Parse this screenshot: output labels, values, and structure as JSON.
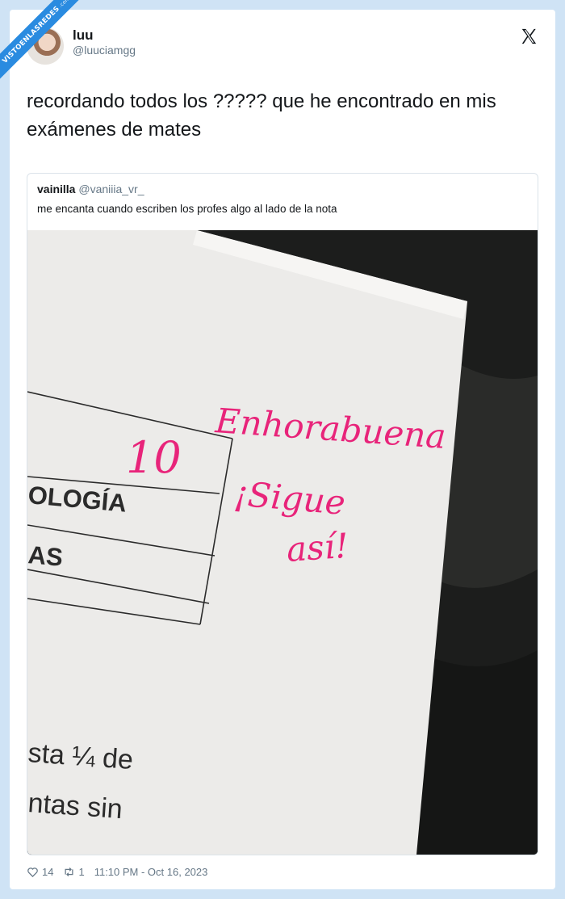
{
  "watermark": {
    "text": "VISTOENLASREDES",
    "suffix": ".com"
  },
  "tweet": {
    "author_name": "luu",
    "author_handle": "@luuciamgg",
    "text": "recordando todos los ????? que he encontrado en mis exámenes de mates",
    "likes": "14",
    "retweets": "1",
    "timestamp": "11:10 PM - Oct 16, 2023"
  },
  "quoted_tweet": {
    "author_name": "vainilla",
    "author_handle": "@vaniiia_vr_",
    "text": "me encanta cuando escriben los profes algo al lado de la nota"
  },
  "photo": {
    "grade": "10",
    "handwriting": [
      "Enhorabuena",
      "¡Sigue",
      "así!"
    ],
    "printed_rows": [
      "OLOGÍA",
      "AS"
    ],
    "printed_text": [
      "sta ¼ de",
      "ntas sin"
    ]
  },
  "icons": {
    "close": "x-logo-icon",
    "like": "heart-icon",
    "retweet": "retweet-icon"
  },
  "colors": {
    "background": "#cfe3f5",
    "ink": "#e8247a",
    "ribbon": "#2a8be0",
    "muted": "#657786"
  }
}
